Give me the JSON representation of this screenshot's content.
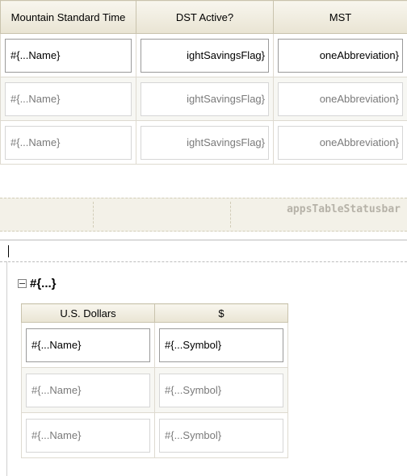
{
  "top_table": {
    "headers": [
      "Mountain Standard Time",
      "DST Active?",
      "MST"
    ],
    "rows": [
      [
        "#{...Name}",
        "ightSavingsFlag}",
        "oneAbbreviation}"
      ],
      [
        "#{...Name}",
        "ightSavingsFlag}",
        "oneAbbreviation}"
      ],
      [
        "#{...Name}",
        "ightSavingsFlag}",
        "oneAbbreviation}"
      ]
    ]
  },
  "statusbar": {
    "label": "appsTableStatusbar"
  },
  "group": {
    "label": "#{...}"
  },
  "bottom_table": {
    "headers": [
      "U.S. Dollars",
      "$"
    ],
    "rows": [
      [
        "#{...Name}",
        "#{...Symbol}"
      ],
      [
        "#{...Name}",
        "#{...Symbol}"
      ],
      [
        "#{...Name}",
        "#{...Symbol}"
      ]
    ]
  }
}
